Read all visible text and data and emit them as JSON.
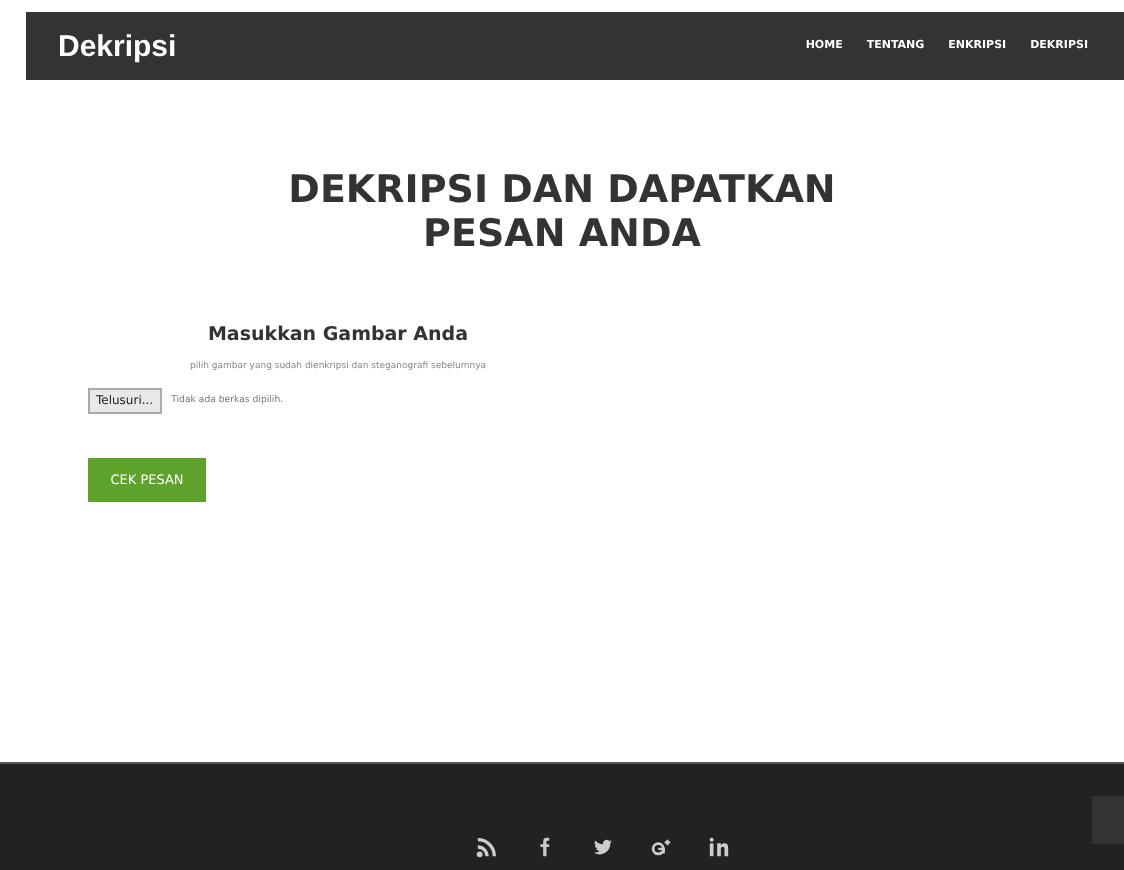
{
  "navbar": {
    "brand": "Dekripsi",
    "links": [
      {
        "label": "HOME"
      },
      {
        "label": "TENTANG"
      },
      {
        "label": "ENKRIPSI"
      },
      {
        "label": "DEKRIPSI"
      }
    ]
  },
  "heading": "DEKRIPSI DAN DAPATKAN PESAN ANDA",
  "form": {
    "title": "Masukkan Gambar Anda",
    "hint": "pilih gambar yang sudah dienkripsi dan steganografi sebelumnya",
    "file_button": "Telusuri...",
    "file_status": "Tidak ada berkas dipilih.",
    "submit": "CEK PESAN"
  },
  "footer": {
    "social": [
      {
        "kind": "rss"
      },
      {
        "kind": "f"
      },
      {
        "kind": "bird"
      },
      {
        "kind": "gplus"
      },
      {
        "kind": "in"
      }
    ]
  }
}
